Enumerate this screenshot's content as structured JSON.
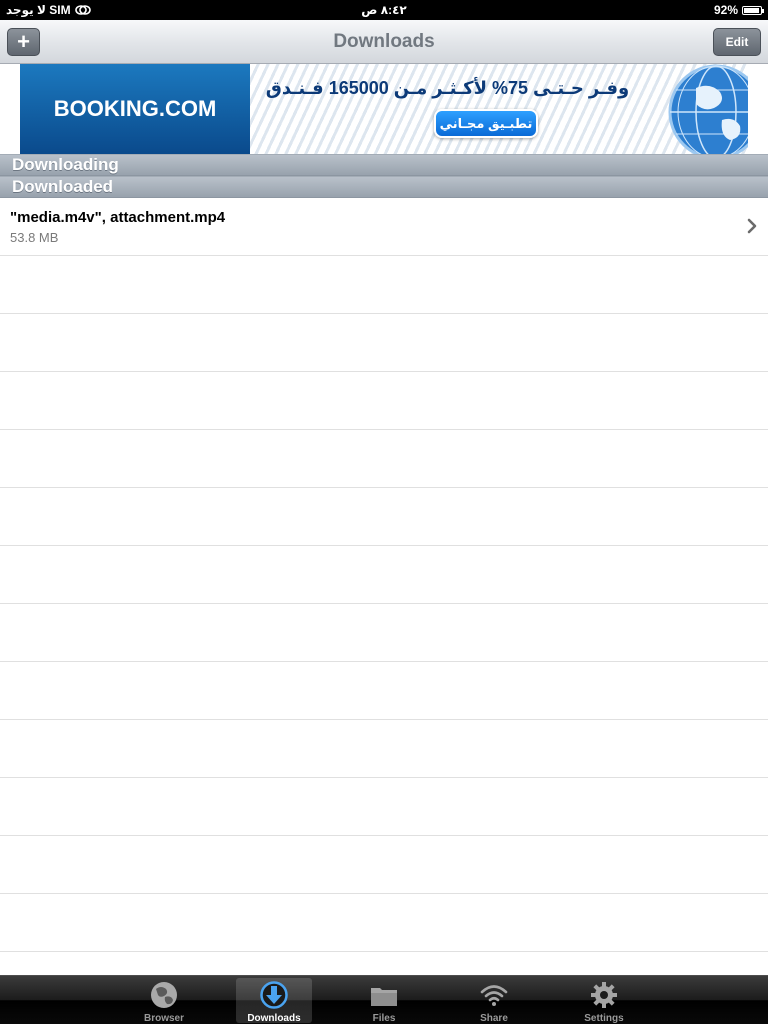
{
  "status_bar": {
    "carrier": "لا يوجد SIM",
    "time": "٨:٤٢ ص",
    "battery": "92%",
    "battery_level": 0.92
  },
  "nav": {
    "title": "Downloads",
    "add_label": "+",
    "edit_label": "Edit"
  },
  "banner": {
    "logo_text": "BOOKING.COM",
    "headline": "وفـر حـتـى 75% لأكـثـر مـن 165000 فـنـدق",
    "cta": "تطبـيق مجـاني"
  },
  "sections": {
    "downloading": "Downloading",
    "downloaded": "Downloaded"
  },
  "downloads": [
    {
      "name": "\"media.m4v\", attachment.mp4",
      "size": "53.8 MB"
    }
  ],
  "empty_rows": 12,
  "tabs": [
    {
      "label": "Browser",
      "icon": "globe-icon",
      "active": false
    },
    {
      "label": "Downloads",
      "icon": "download-arrow-icon",
      "active": true
    },
    {
      "label": "Files",
      "icon": "folder-icon",
      "active": false
    },
    {
      "label": "Share",
      "icon": "wifi-icon",
      "active": false
    },
    {
      "label": "Settings",
      "icon": "gear-icon",
      "active": false
    }
  ],
  "colors": {
    "accent_blue": "#1c79bf",
    "nav_title": "#717880",
    "section_header": "#a8b1bb",
    "tab_bar": "#111111"
  }
}
